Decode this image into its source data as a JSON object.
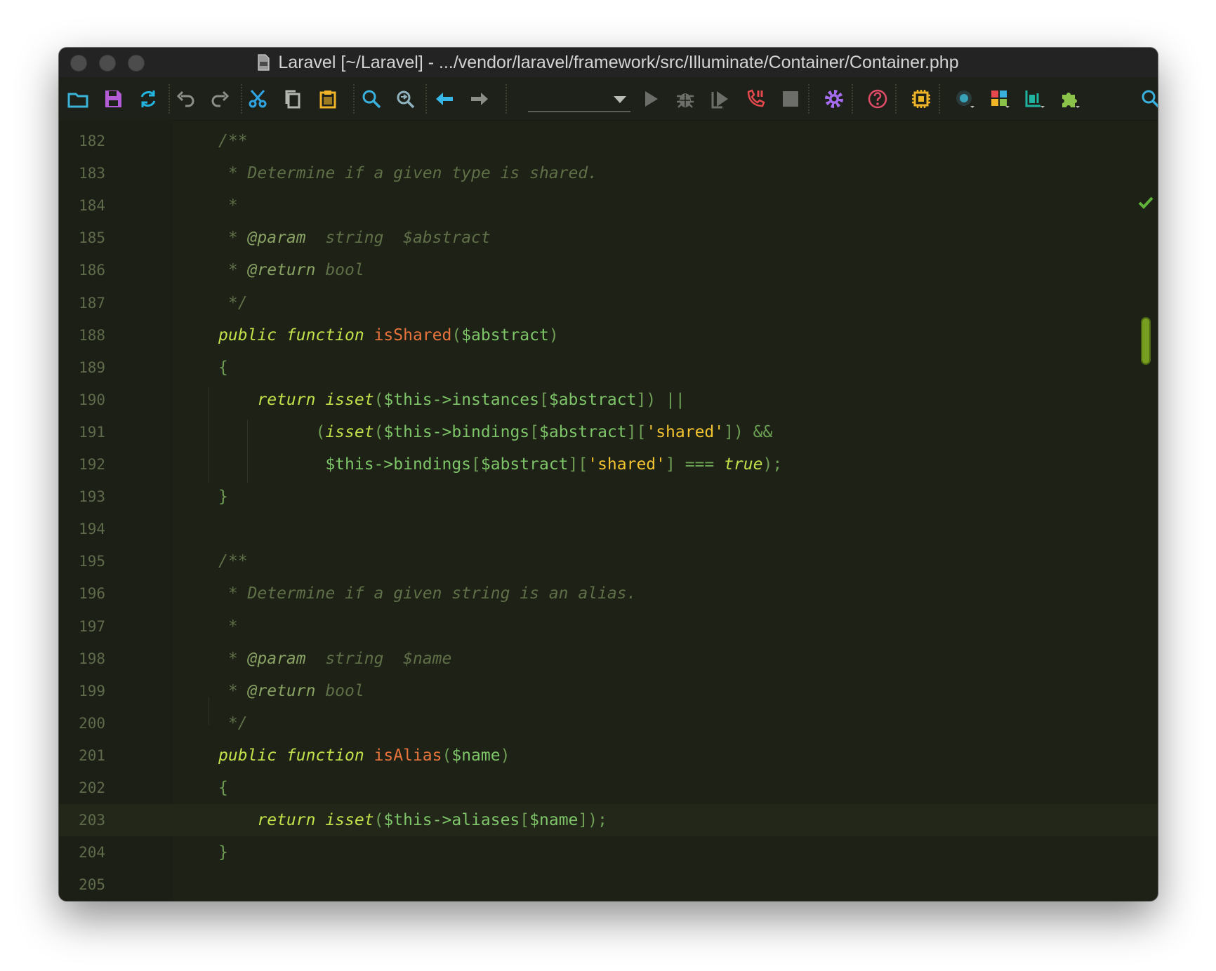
{
  "window": {
    "title": "Laravel [~/Laravel] - .../vendor/laravel/framework/src/Illuminate/Container/Container.php"
  },
  "toolbar": {
    "buttons": [
      {
        "name": "open-folder-icon",
        "color": "#3bb4d9"
      },
      {
        "name": "save-icon",
        "color": "#b25cd6"
      },
      {
        "name": "sync-icon",
        "color": "#23b4e0"
      },
      {
        "name": "undo-icon",
        "color": "#8b8e86"
      },
      {
        "name": "redo-icon",
        "color": "#8b8e86"
      },
      {
        "name": "cut-icon",
        "color": "#2fa4e3"
      },
      {
        "name": "copy-icon",
        "color": "#b3b6af"
      },
      {
        "name": "paste-icon",
        "color": "#f0b429"
      },
      {
        "name": "find-icon",
        "color": "#3ab0dd"
      },
      {
        "name": "replace-icon",
        "color": "#8fb3bf"
      },
      {
        "name": "back-arrow-icon",
        "color": "#37b7e8"
      },
      {
        "name": "forward-arrow-icon",
        "color": "#8b8e86"
      },
      {
        "name": "run-icon",
        "color": "#6c6f69"
      },
      {
        "name": "debug-icon",
        "color": "#6c6f69"
      },
      {
        "name": "run-coverage-icon",
        "color": "#6c6f69"
      },
      {
        "name": "phone-listen-icon",
        "color": "#e5484d"
      },
      {
        "name": "stop-icon",
        "color": "#6c6f69"
      },
      {
        "name": "settings-gear-icon",
        "color": "#a66cf0"
      },
      {
        "name": "help-icon",
        "color": "#e04b67"
      },
      {
        "name": "chip-icon",
        "color": "#f0b429"
      },
      {
        "name": "record-icon",
        "color": "#37a2b8"
      },
      {
        "name": "layout-icon",
        "color": "#e5484d"
      },
      {
        "name": "data-icon",
        "color": "#1fb3a0"
      },
      {
        "name": "plugin-icon",
        "color": "#8bc34a"
      },
      {
        "name": "search-icon",
        "color": "#3ab0dd"
      }
    ],
    "run_config": {
      "value": ""
    }
  },
  "editor": {
    "current_line": 203,
    "status": "no-problems",
    "lines": [
      {
        "n": "182",
        "t": [
          [
            "c",
            "/**"
          ]
        ]
      },
      {
        "n": "183",
        "t": [
          [
            "c",
            " * Determine if a given type is shared."
          ]
        ]
      },
      {
        "n": "184",
        "t": [
          [
            "c",
            " *"
          ]
        ]
      },
      {
        "n": "185",
        "t": [
          [
            "c",
            " * "
          ],
          [
            "tag",
            "@param"
          ],
          [
            "c",
            "  string  $abstract"
          ]
        ]
      },
      {
        "n": "186",
        "t": [
          [
            "c",
            " * "
          ],
          [
            "tag",
            "@return"
          ],
          [
            "c",
            " bool"
          ]
        ]
      },
      {
        "n": "187",
        "t": [
          [
            "c",
            " */"
          ]
        ]
      },
      {
        "n": "188",
        "t": [
          [
            "k",
            "public function "
          ],
          [
            "fn",
            "isShared"
          ],
          [
            "p",
            "("
          ],
          [
            "v",
            "$abstract"
          ],
          [
            "p",
            ")"
          ]
        ]
      },
      {
        "n": "189",
        "t": [
          [
            "p",
            "{"
          ]
        ]
      },
      {
        "n": "190",
        "t": [
          [
            "k",
            "    return isset"
          ],
          [
            "p",
            "("
          ],
          [
            "v",
            "$this->instances"
          ],
          [
            "p",
            "["
          ],
          [
            "v",
            "$abstract"
          ],
          [
            "p",
            "]) "
          ],
          [
            "op",
            "||"
          ]
        ]
      },
      {
        "n": "191",
        "t": [
          [
            "p",
            "          ("
          ],
          [
            "k",
            "isset"
          ],
          [
            "p",
            "("
          ],
          [
            "v",
            "$this->bindings"
          ],
          [
            "p",
            "["
          ],
          [
            "v",
            "$abstract"
          ],
          [
            "p",
            "]["
          ],
          [
            "s",
            "'shared'"
          ],
          [
            "p",
            "]) "
          ],
          [
            "op",
            "&&"
          ]
        ]
      },
      {
        "n": "192",
        "t": [
          [
            "v",
            "           $this->bindings"
          ],
          [
            "p",
            "["
          ],
          [
            "v",
            "$abstract"
          ],
          [
            "p",
            "]["
          ],
          [
            "s",
            "'shared'"
          ],
          [
            "p",
            "] "
          ],
          [
            "op",
            "==="
          ],
          [
            "p",
            " "
          ],
          [
            "k",
            "true"
          ],
          [
            "p",
            ");"
          ]
        ]
      },
      {
        "n": "193",
        "t": [
          [
            "p",
            "}"
          ]
        ]
      },
      {
        "n": "194",
        "t": []
      },
      {
        "n": "195",
        "t": [
          [
            "c",
            "/**"
          ]
        ]
      },
      {
        "n": "196",
        "t": [
          [
            "c",
            " * Determine if a given string is an alias."
          ]
        ]
      },
      {
        "n": "197",
        "t": [
          [
            "c",
            " *"
          ]
        ]
      },
      {
        "n": "198",
        "t": [
          [
            "c",
            " * "
          ],
          [
            "tag",
            "@param"
          ],
          [
            "c",
            "  string  $name"
          ]
        ]
      },
      {
        "n": "199",
        "t": [
          [
            "c",
            " * "
          ],
          [
            "tag",
            "@return"
          ],
          [
            "c",
            " bool"
          ]
        ]
      },
      {
        "n": "200",
        "t": [
          [
            "c",
            " */"
          ]
        ]
      },
      {
        "n": "201",
        "t": [
          [
            "k",
            "public function "
          ],
          [
            "fn",
            "isAlias"
          ],
          [
            "p",
            "("
          ],
          [
            "v",
            "$name"
          ],
          [
            "p",
            ")"
          ]
        ]
      },
      {
        "n": "202",
        "t": [
          [
            "p",
            "{"
          ]
        ]
      },
      {
        "n": "203",
        "t": [
          [
            "k",
            "    return isset"
          ],
          [
            "p",
            "("
          ],
          [
            "v",
            "$this->aliases"
          ],
          [
            "p",
            "["
          ],
          [
            "v",
            "$name"
          ],
          [
            "p",
            "]);"
          ]
        ]
      },
      {
        "n": "204",
        "t": [
          [
            "p",
            "}"
          ]
        ]
      },
      {
        "n": "205",
        "t": []
      }
    ]
  }
}
